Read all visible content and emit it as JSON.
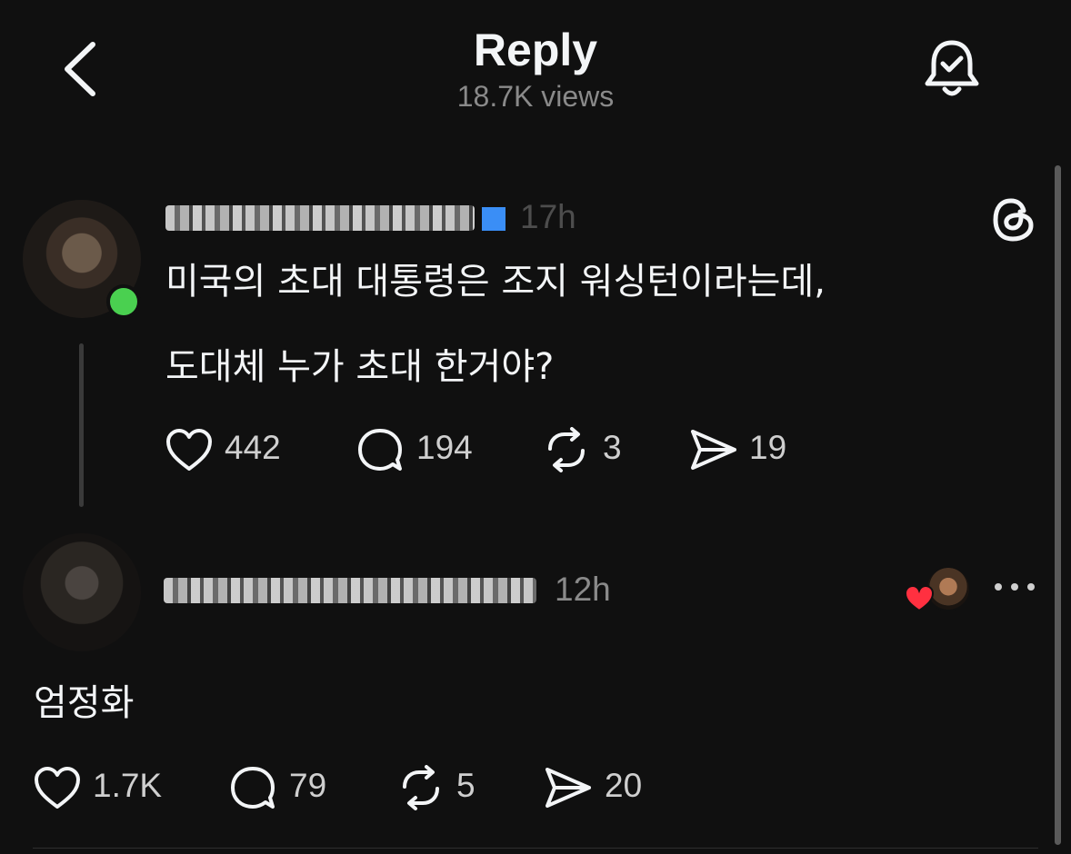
{
  "header": {
    "title": "Reply",
    "views": "18.7K views"
  },
  "post": {
    "time": "17h",
    "line1": "미국의 초대 대통령은 조지 워싱턴이라는데,",
    "line2": "도대체 누가 초대 한거야?",
    "likes": "442",
    "comments": "194",
    "reposts": "3",
    "shares": "19"
  },
  "reply": {
    "time": "12h",
    "text": "엄정화",
    "likes": "1.7K",
    "comments": "79",
    "reposts": "5",
    "shares": "20"
  },
  "colors": {
    "background": "#101010",
    "text": "#f3f5f7",
    "muted": "#8a8a8a",
    "online": "#4ad050",
    "verified": "#3a8ef6",
    "heart": "#ff3040"
  }
}
